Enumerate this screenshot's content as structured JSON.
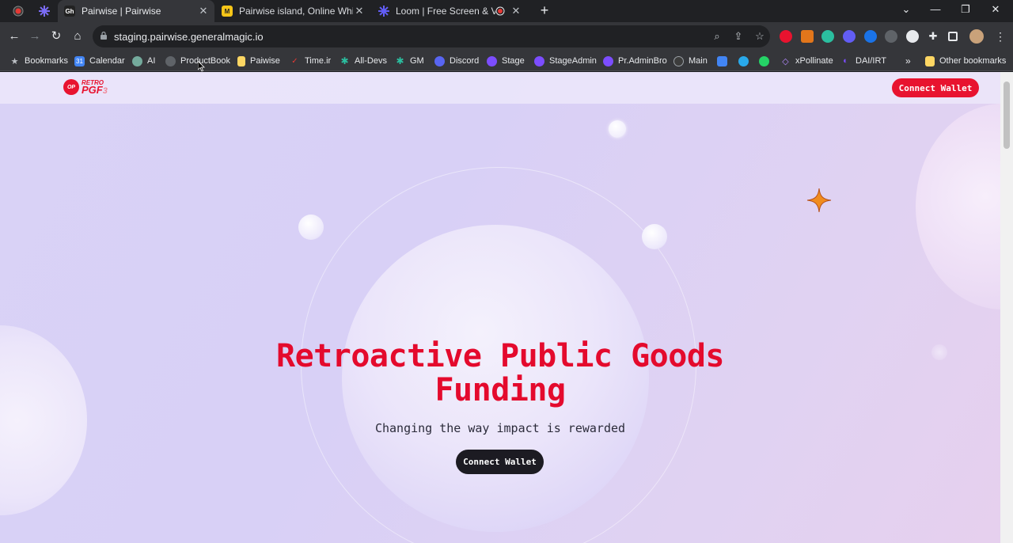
{
  "browser": {
    "tabs": [
      {
        "title": "Pairwise | Pairwise",
        "favicon": "Gh",
        "active": true
      },
      {
        "title": "Pairwise island, Online Whiteboa",
        "favicon": "M",
        "active": false
      },
      {
        "title": "Loom | Free Screen & Video",
        "favicon": "loom",
        "active": false
      }
    ],
    "url": "staging.pairwise.generalmagic.io",
    "bookmarks": [
      {
        "label": "Bookmarks",
        "icon": "star-icon"
      },
      {
        "label": "Calendar",
        "icon": "calendar-icon"
      },
      {
        "label": "AI",
        "icon": "openai-icon"
      },
      {
        "label": "ProductBook",
        "icon": "globe-icon"
      },
      {
        "label": "Paiwise",
        "icon": "folder-icon"
      },
      {
        "label": "Time.ir",
        "icon": "check-icon"
      },
      {
        "label": "All-Devs",
        "icon": "snowflake-icon"
      },
      {
        "label": "GM",
        "icon": "snowflake-icon"
      },
      {
        "label": "Discord",
        "icon": "discord-icon"
      },
      {
        "label": "Stage",
        "icon": "stage-icon"
      },
      {
        "label": "StageAdmin",
        "icon": "stage-icon"
      },
      {
        "label": "Pr.AdminBro",
        "icon": "stage-icon"
      },
      {
        "label": "Main",
        "icon": "github-icon"
      },
      {
        "label": "",
        "icon": "translate-icon"
      },
      {
        "label": "",
        "icon": "telegram-icon"
      },
      {
        "label": "",
        "icon": "whatsapp-icon"
      },
      {
        "label": "xPollinate",
        "icon": "xpollinate-icon"
      },
      {
        "label": "DAI/IRT",
        "icon": "dai-icon"
      },
      {
        "label": "»",
        "icon": "overflow-icon"
      },
      {
        "label": "Other bookmarks",
        "icon": "folder-icon"
      }
    ]
  },
  "page": {
    "logo": {
      "badge": "OP",
      "line1": "RETRO",
      "line2": "PGF",
      "number": "3"
    },
    "header_button": "Connect Wallet",
    "hero": {
      "title": "Retroactive Public Goods Funding",
      "subtitle": "Changing the way impact is rewarded",
      "button": "Connect Wallet"
    },
    "colors": {
      "accent": "#e8132f",
      "title": "#e40a2d",
      "dark_button": "#1c1b22",
      "background": "#d9d2f6"
    }
  }
}
